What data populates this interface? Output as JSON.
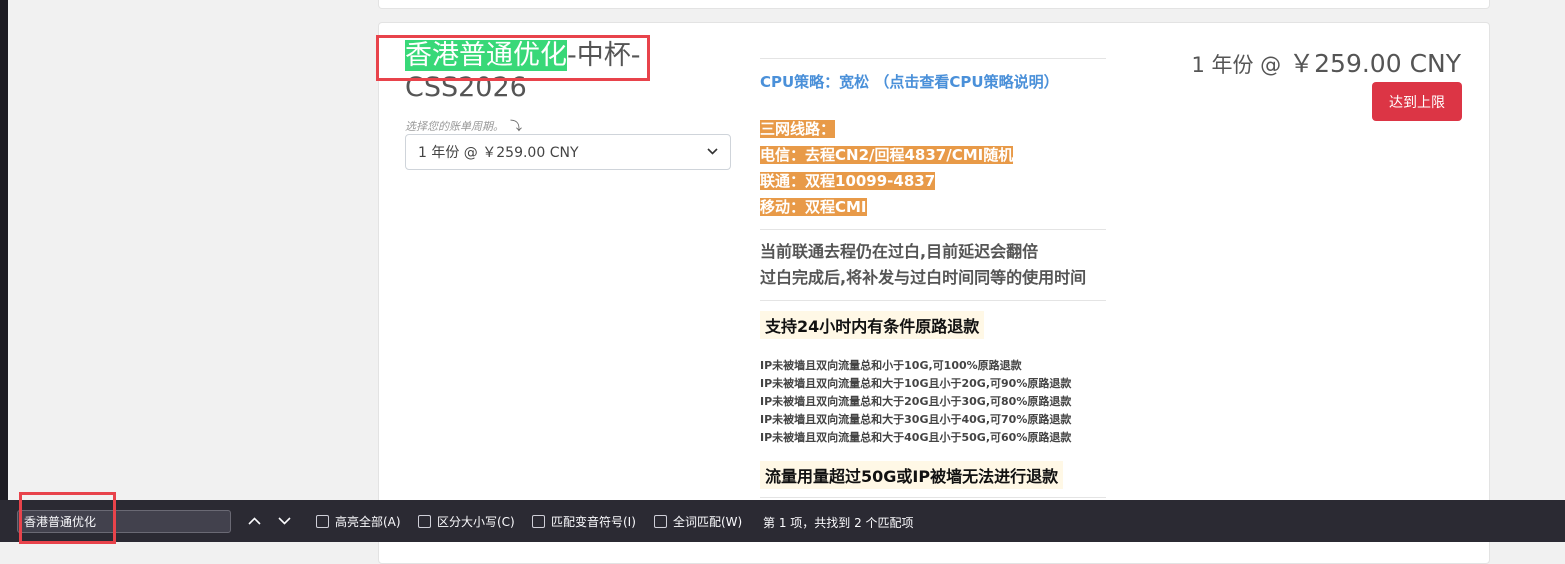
{
  "product": {
    "title_highlight": "香港普通优化",
    "title_rest": "-中杯-CSS2026",
    "billing_hint": "选择您的账单周期。",
    "billing_hint_icon": "curved-arrow-down-icon",
    "selected_cycle": "1 年份 @ ￥259.00 CNY",
    "price_cycle": "1 年份 @",
    "price_value": "￥259.00 CNY",
    "limit_button": "达到上限",
    "limit_button_color": "#dc3545",
    "title_highlight_color": "#38d878"
  },
  "description": {
    "cpu_policy": "CPU策略：宽松 （点击查看CPU策略说明）",
    "routes": [
      "三网线路：",
      "电信：去程CN2/回程4837/CMI随机",
      "联通：双程10099-4837",
      "移动：双程CMI"
    ],
    "route_color": "#e89a48",
    "notice_lines": [
      "当前联通去程仍在过白,目前延迟会翻倍",
      "过白完成后,将补发与过白时间同等的使用时间"
    ],
    "refund_banner": "支持24小时内有条件原路退款",
    "refund_rules": [
      "IP未被墙且双向流量总和小于10G,可100%原路退款",
      "IP未被墙且双向流量总和大于10G且小于20G,可90%原路退款",
      "IP未被墙且双向流量总和大于20G且小于30G,可80%原路退款",
      "IP未被墙且双向流量总和大于30G且小于40G,可70%原路退款",
      "IP未被墙且双向流量总和大于40G且小于50G,可60%原路退款"
    ],
    "no_refund_banner": "流量用量超过50G或IP被墙无法进行退款"
  },
  "findbar": {
    "query": "香港普通优化",
    "prev_icon": "chevron-up-icon",
    "next_icon": "chevron-down-icon",
    "highlight_all": "高亮全部(A)",
    "match_case": "区分大小写(C)",
    "match_diacritics": "匹配变音符号(I)",
    "whole_words": "全词匹配(W)",
    "status": "第 1 项，共找到 2 个匹配项"
  }
}
